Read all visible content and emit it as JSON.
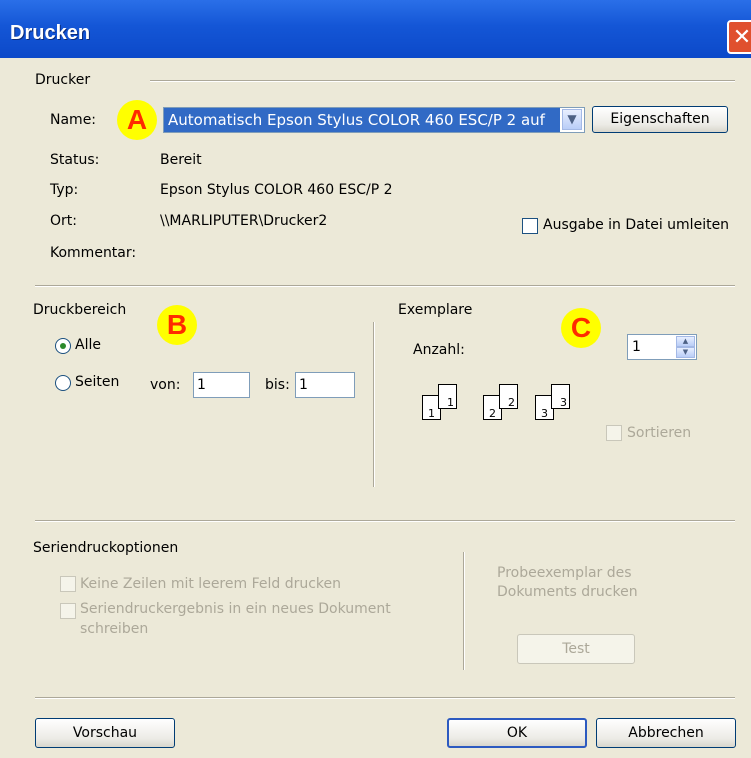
{
  "window": {
    "title": "Drucken",
    "close_label": "✕"
  },
  "printer": {
    "section_label": "Drucker",
    "name_label": "Name:",
    "name_value": "Automatisch Epson Stylus COLOR 460 ESC/P 2 auf",
    "properties_button": "Eigenschaften",
    "status_label": "Status:",
    "status_value": "Bereit",
    "type_label": "Typ:",
    "type_value": "Epson Stylus COLOR 460 ESC/P 2",
    "location_label": "Ort:",
    "location_value": "\\\\MARLIPUTER\\Drucker2",
    "comment_label": "Kommentar:",
    "print_to_file_label": "Ausgabe in Datei umleiten"
  },
  "badges": {
    "a": "A",
    "b": "B",
    "c": "C",
    "color_fill": "#ffff00",
    "color_text": "#ff2a00"
  },
  "print_range": {
    "section_label": "Druckbereich",
    "all_label": "Alle",
    "pages_label": "Seiten",
    "from_label": "von:",
    "from_value": "1",
    "to_label": "bis:",
    "to_value": "1"
  },
  "copies": {
    "section_label": "Exemplare",
    "count_label": "Anzahl:",
    "count_value": "1",
    "collate_label": "Sortieren",
    "page_numbers": [
      "1",
      "1",
      "2",
      "2",
      "3",
      "3"
    ]
  },
  "mailmerge": {
    "section_label": "Seriendruckoptionen",
    "skip_empty_label": "Keine Zeilen mit leerem Feld drucken",
    "new_document_label_line1": "Seriendruckergebnis in ein neues Dokument",
    "new_document_label_line2": "schreiben",
    "sample_label_line1": "Probeexemplar des",
    "sample_label_line2": "Dokuments drucken",
    "test_button": "Test"
  },
  "footer": {
    "preview_button": "Vorschau",
    "ok_button": "OK",
    "cancel_button": "Abbrechen"
  },
  "colors": {
    "titlebar": "#0c49c9",
    "selection": "#316ac5",
    "dialog_bg": "#ece9d8"
  }
}
